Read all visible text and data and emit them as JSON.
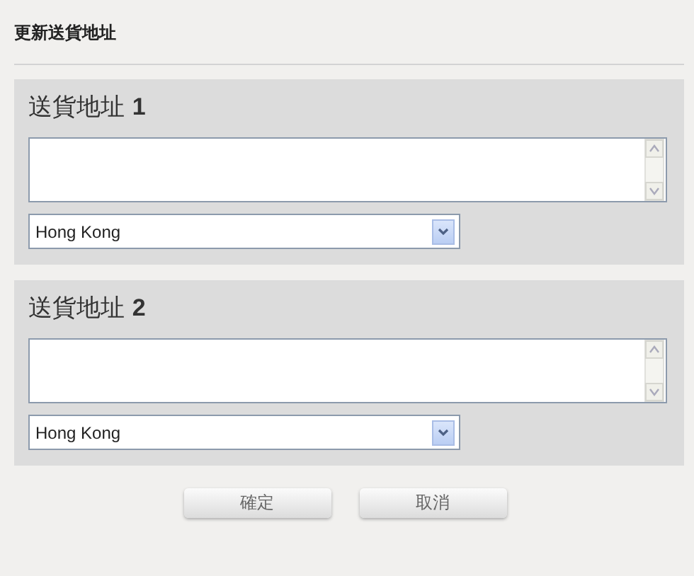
{
  "title": "更新送貨地址",
  "addresses": [
    {
      "heading": "送貨地址 **1**",
      "country": "Hong Kong"
    },
    {
      "heading": "送貨地址 **2**",
      "country": "Hong Kong"
    }
  ],
  "buttons": [
    "確定",
    "取消"
  ]
}
